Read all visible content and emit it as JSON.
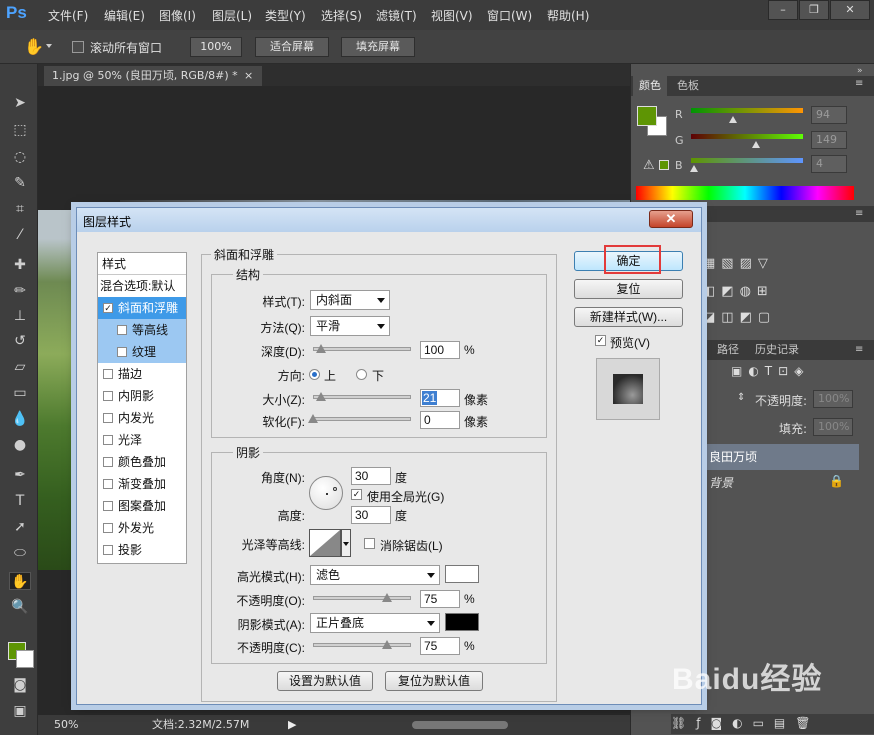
{
  "app": {
    "logo": "Ps"
  },
  "menu": [
    "文件(F)",
    "编辑(E)",
    "图像(I)",
    "图层(L)",
    "类型(Y)",
    "选择(S)",
    "滤镜(T)",
    "视图(V)",
    "窗口(W)",
    "帮助(H)"
  ],
  "window_controls": {
    "minimize": "–",
    "restore": "❐",
    "close": "✕"
  },
  "options_bar": {
    "scroll_all_label": "滚动所有窗口",
    "zoom_100": "100%",
    "fit_screen": "适合屏幕",
    "fill_screen": "填充屏幕"
  },
  "document": {
    "tab_title": "1.jpg @ 50% (良田万顷, RGB/8#) *",
    "tab_close": "×"
  },
  "status": {
    "zoom": "50%",
    "doc_info": "文档:2.32M/2.57M"
  },
  "color_panel": {
    "tabs": [
      "颜色",
      "色板"
    ],
    "r_label": "R",
    "g_label": "G",
    "b_label": "B",
    "r_value": "94",
    "g_value": "149",
    "b_value": "4",
    "foreground": "#5e9504",
    "background": "#ffffff"
  },
  "layers_panel": {
    "tabs": [
      "路径",
      "历史记录"
    ],
    "opacity_label": "不透明度:",
    "opacity_value": "100%",
    "fill_label": "填充:",
    "fill_value": "100%",
    "layers": [
      "良田万顷",
      "背景"
    ]
  },
  "dialog": {
    "title": "图层样式",
    "close": "✕",
    "style_list_header": "样式",
    "blend_options": "混合选项:默认",
    "styles": [
      {
        "label": "斜面和浮雕",
        "checked": true
      },
      {
        "label": "等高线",
        "checked": false
      },
      {
        "label": "纹理",
        "checked": false
      },
      {
        "label": "描边",
        "checked": false
      },
      {
        "label": "内阴影",
        "checked": false
      },
      {
        "label": "内发光",
        "checked": false
      },
      {
        "label": "光泽",
        "checked": false
      },
      {
        "label": "颜色叠加",
        "checked": false
      },
      {
        "label": "渐变叠加",
        "checked": false
      },
      {
        "label": "图案叠加",
        "checked": false
      },
      {
        "label": "外发光",
        "checked": false
      },
      {
        "label": "投影",
        "checked": false
      }
    ],
    "bevel": {
      "group_title": "斜面和浮雕",
      "structure_title": "结构",
      "style_label": "样式(T):",
      "style_value": "内斜面",
      "technique_label": "方法(Q):",
      "technique_value": "平滑",
      "depth_label": "深度(D):",
      "depth_value": "100",
      "depth_unit": "%",
      "depth_level": 0.08,
      "direction_label": "方向:",
      "direction_up": "上",
      "direction_down": "下",
      "size_label": "大小(Z):",
      "size_value": "21",
      "size_unit": "像素",
      "size_level": 0.08,
      "soften_label": "软化(F):",
      "soften_value": "0",
      "soften_unit": "像素",
      "soften_level": 0.0
    },
    "shading": {
      "title": "阴影",
      "angle_label": "角度(N):",
      "angle_value": "30",
      "angle_unit": "度",
      "global_light_label": "使用全局光(G)",
      "altitude_label": "高度:",
      "altitude_value": "30",
      "altitude_unit": "度",
      "gloss_contour_label": "光泽等高线:",
      "anti_aliased_label": "消除锯齿(L)",
      "highlight_mode_label": "高光模式(H):",
      "highlight_mode_value": "滤色",
      "highlight_color": "#ffffff",
      "highlight_opacity_label": "不透明度(O):",
      "highlight_opacity_value": "75",
      "highlight_opacity_unit": "%",
      "highlight_opacity_level": 0.75,
      "shadow_mode_label": "阴影模式(A):",
      "shadow_mode_value": "正片叠底",
      "shadow_color": "#000000",
      "shadow_opacity_label": "不透明度(C):",
      "shadow_opacity_value": "75",
      "shadow_opacity_unit": "%",
      "shadow_opacity_level": 0.75
    },
    "make_default": "设置为默认值",
    "reset_default": "复位为默认值",
    "ok": "确定",
    "reset": "复位",
    "new_style": "新建样式(W)...",
    "preview_label": "预览(V)"
  },
  "watermark": "Baidu经验"
}
